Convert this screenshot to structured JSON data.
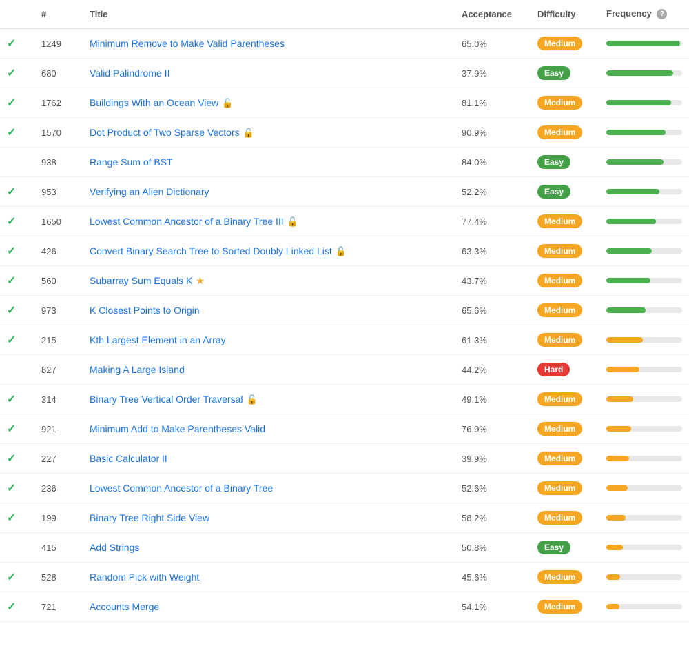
{
  "header": {
    "col_check": "",
    "col_num": "#",
    "col_title": "Title",
    "col_acceptance": "Acceptance",
    "col_difficulty": "Difficulty",
    "col_frequency": "Frequency"
  },
  "rows": [
    {
      "solved": true,
      "num": "1249",
      "title": "Minimum Remove to Make Valid Parentheses",
      "lock": false,
      "star": false,
      "acceptance": "65.0%",
      "difficulty": "Medium",
      "freq_pct": 97,
      "freq_color": "green"
    },
    {
      "solved": true,
      "num": "680",
      "title": "Valid Palindrome II",
      "lock": false,
      "star": false,
      "acceptance": "37.9%",
      "difficulty": "Easy",
      "freq_pct": 88,
      "freq_color": "green"
    },
    {
      "solved": true,
      "num": "1762",
      "title": "Buildings With an Ocean View",
      "lock": true,
      "star": false,
      "acceptance": "81.1%",
      "difficulty": "Medium",
      "freq_pct": 85,
      "freq_color": "green"
    },
    {
      "solved": true,
      "num": "1570",
      "title": "Dot Product of Two Sparse Vectors",
      "lock": true,
      "star": false,
      "acceptance": "90.9%",
      "difficulty": "Medium",
      "freq_pct": 78,
      "freq_color": "green"
    },
    {
      "solved": false,
      "num": "938",
      "title": "Range Sum of BST",
      "lock": false,
      "star": false,
      "acceptance": "84.0%",
      "difficulty": "Easy",
      "freq_pct": 75,
      "freq_color": "green"
    },
    {
      "solved": true,
      "num": "953",
      "title": "Verifying an Alien Dictionary",
      "lock": false,
      "star": false,
      "acceptance": "52.2%",
      "difficulty": "Easy",
      "freq_pct": 70,
      "freq_color": "green"
    },
    {
      "solved": true,
      "num": "1650",
      "title": "Lowest Common Ancestor of a Binary Tree III",
      "lock": true,
      "star": false,
      "acceptance": "77.4%",
      "difficulty": "Medium",
      "freq_pct": 65,
      "freq_color": "green"
    },
    {
      "solved": true,
      "num": "426",
      "title": "Convert Binary Search Tree to Sorted Doubly Linked List",
      "lock": true,
      "star": false,
      "acceptance": "63.3%",
      "difficulty": "Medium",
      "freq_pct": 60,
      "freq_color": "green"
    },
    {
      "solved": true,
      "num": "560",
      "title": "Subarray Sum Equals K",
      "lock": false,
      "star": true,
      "acceptance": "43.7%",
      "difficulty": "Medium",
      "freq_pct": 58,
      "freq_color": "green"
    },
    {
      "solved": true,
      "num": "973",
      "title": "K Closest Points to Origin",
      "lock": false,
      "star": false,
      "acceptance": "65.6%",
      "difficulty": "Medium",
      "freq_pct": 52,
      "freq_color": "green"
    },
    {
      "solved": true,
      "num": "215",
      "title": "Kth Largest Element in an Array",
      "lock": false,
      "star": false,
      "acceptance": "61.3%",
      "difficulty": "Medium",
      "freq_pct": 48,
      "freq_color": "orange"
    },
    {
      "solved": false,
      "num": "827",
      "title": "Making A Large Island",
      "lock": false,
      "star": false,
      "acceptance": "44.2%",
      "difficulty": "Hard",
      "freq_pct": 44,
      "freq_color": "orange"
    },
    {
      "solved": true,
      "num": "314",
      "title": "Binary Tree Vertical Order Traversal",
      "lock": true,
      "star": false,
      "acceptance": "49.1%",
      "difficulty": "Medium",
      "freq_pct": 35,
      "freq_color": "orange"
    },
    {
      "solved": true,
      "num": "921",
      "title": "Minimum Add to Make Parentheses Valid",
      "lock": false,
      "star": false,
      "acceptance": "76.9%",
      "difficulty": "Medium",
      "freq_pct": 33,
      "freq_color": "orange"
    },
    {
      "solved": true,
      "num": "227",
      "title": "Basic Calculator II",
      "lock": false,
      "star": false,
      "acceptance": "39.9%",
      "difficulty": "Medium",
      "freq_pct": 30,
      "freq_color": "orange"
    },
    {
      "solved": true,
      "num": "236",
      "title": "Lowest Common Ancestor of a Binary Tree",
      "lock": false,
      "star": false,
      "acceptance": "52.6%",
      "difficulty": "Medium",
      "freq_pct": 28,
      "freq_color": "orange"
    },
    {
      "solved": true,
      "num": "199",
      "title": "Binary Tree Right Side View",
      "lock": false,
      "star": false,
      "acceptance": "58.2%",
      "difficulty": "Medium",
      "freq_pct": 25,
      "freq_color": "orange"
    },
    {
      "solved": false,
      "num": "415",
      "title": "Add Strings",
      "lock": false,
      "star": false,
      "acceptance": "50.8%",
      "difficulty": "Easy",
      "freq_pct": 22,
      "freq_color": "orange"
    },
    {
      "solved": true,
      "num": "528",
      "title": "Random Pick with Weight",
      "lock": false,
      "star": false,
      "acceptance": "45.6%",
      "difficulty": "Medium",
      "freq_pct": 18,
      "freq_color": "orange"
    },
    {
      "solved": true,
      "num": "721",
      "title": "Accounts Merge",
      "lock": false,
      "star": false,
      "acceptance": "54.1%",
      "difficulty": "Medium",
      "freq_pct": 17,
      "freq_color": "orange"
    }
  ]
}
